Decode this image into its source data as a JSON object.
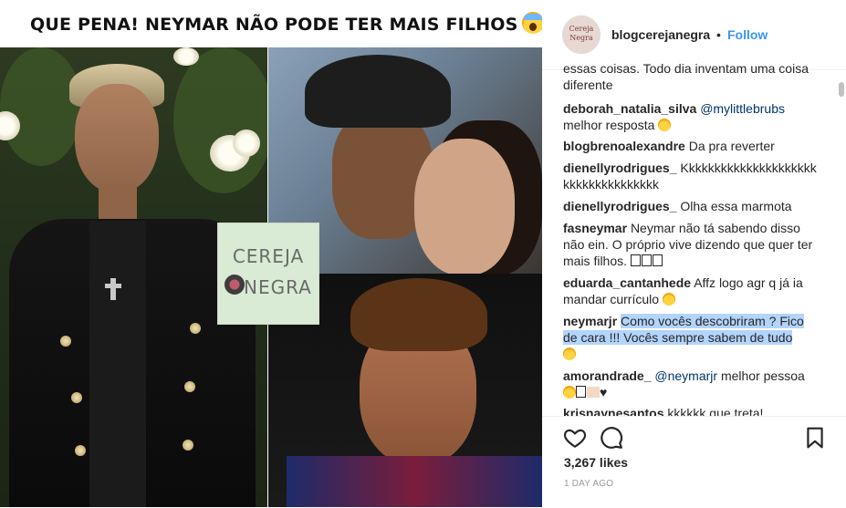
{
  "post": {
    "headline": "QUE PENA! NEYMAR NÃO PODE TER MAIS FILHOS",
    "watermark_line1": "CEREJA",
    "watermark_line2": "NEGRA"
  },
  "header": {
    "avatar_text": "Cereja Negra",
    "username": "blogcerejanegra",
    "separator": "•",
    "follow_label": "Follow"
  },
  "comments": [
    {
      "user": "",
      "text": "essas coisas. Todo dia inventam uma coisa diferente"
    },
    {
      "user": "deborah_natalia_silva",
      "mention": "@mylittlebrubs",
      "text": "melhor resposta"
    },
    {
      "user": "blogbrenoalexandre",
      "text": "Da pra reverter"
    },
    {
      "user": "dienellyrodrigues_",
      "text": "Kkkkkkkkkkkkkkkkkkkkkkkkkkkkkkkkkkkk"
    },
    {
      "user": "dienellyrodrigues_",
      "text": "Olha essa marmota"
    },
    {
      "user": "fasneymar",
      "text": "Neymar não tá sabendo disso não ein. O próprio vive dizendo que quer ter mais filhos."
    },
    {
      "user": "eduarda_cantanhede",
      "text": "Affz logo agr q já ia mandar currículo"
    },
    {
      "user": "neymarjr",
      "text": "Como vocês descobriram ? Fico de cara !!! Vocês sempre sabem de tudo"
    },
    {
      "user": "amorandrade_",
      "mention": "@neymarjr",
      "text": "melhor pessoa"
    },
    {
      "user": "krisnaynesantos",
      "text": "kkkkkk que treta!"
    }
  ],
  "footer": {
    "likes": "3,267 likes",
    "time": "1 DAY AGO"
  },
  "icons": [
    "heart-icon",
    "comment-icon",
    "bookmark-icon",
    "shocked-face-emoji"
  ],
  "colors": {
    "link": "#3897f0",
    "text": "#262626",
    "muted": "#999999",
    "selection": "#b3d4fc"
  }
}
